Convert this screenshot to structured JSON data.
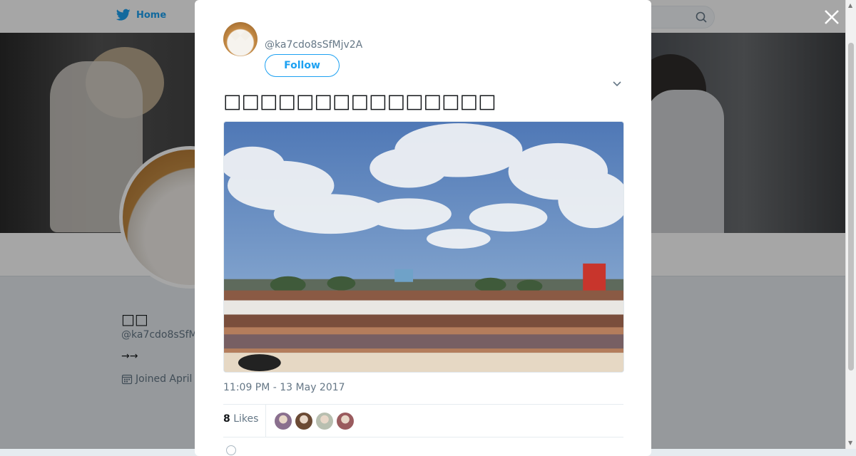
{
  "nav": {
    "home_label": "Home"
  },
  "profile": {
    "name": "□□",
    "handle": "@ka7cdo8sSfM",
    "bio": "→→",
    "joined": "Joined April"
  },
  "tweet": {
    "handle": "@ka7cdo8sSfMjv2A",
    "follow_label": "Follow",
    "text": "□□□□□□□□□□□□□□□",
    "timestamp": "11:09 PM - 13 May 2017",
    "likes_count": "8",
    "likes_label": "Likes"
  },
  "likers": [
    {
      "color": "#8a6f8e"
    },
    {
      "color": "#6b4a34"
    },
    {
      "color": "#b8bfb0"
    },
    {
      "color": "#9a5b5e"
    }
  ],
  "colors": {
    "accent": "#1da1f2",
    "text_secondary": "#657786"
  },
  "icons": [
    "twitter-bird-icon",
    "search-icon",
    "close-icon",
    "chevron-down-icon",
    "calendar-icon"
  ]
}
